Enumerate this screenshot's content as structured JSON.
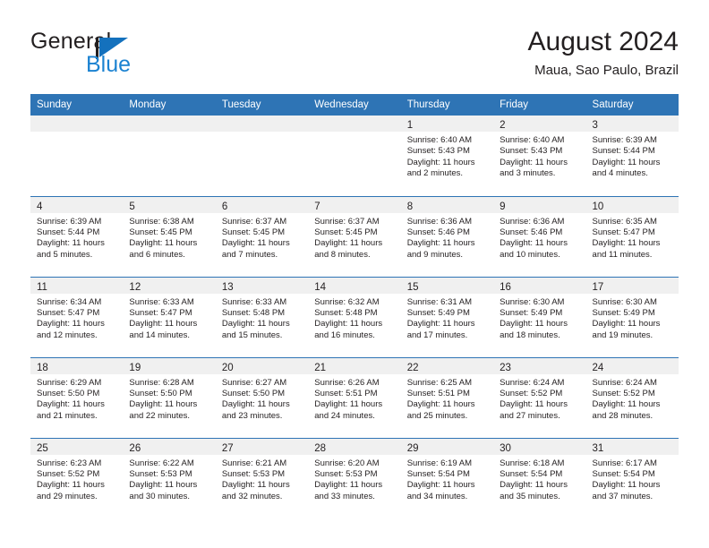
{
  "brand": {
    "name_top": "General",
    "name_bottom": "Blue",
    "flag_color": "#1471bd",
    "blue_text_color": "#1b82d1"
  },
  "header": {
    "title": "August 2024",
    "location": "Maua, Sao Paulo, Brazil"
  },
  "theme": {
    "header_blue": "#2e74b5",
    "day_band_gray": "#f0f0f0",
    "text_color": "#231f20"
  },
  "weekday_headers": [
    "Sunday",
    "Monday",
    "Tuesday",
    "Wednesday",
    "Thursday",
    "Friday",
    "Saturday"
  ],
  "weeks": [
    [
      {
        "day": "",
        "sunrise": "",
        "sunset": "",
        "daylight_line1": "",
        "daylight_line2": ""
      },
      {
        "day": "",
        "sunrise": "",
        "sunset": "",
        "daylight_line1": "",
        "daylight_line2": ""
      },
      {
        "day": "",
        "sunrise": "",
        "sunset": "",
        "daylight_line1": "",
        "daylight_line2": ""
      },
      {
        "day": "",
        "sunrise": "",
        "sunset": "",
        "daylight_line1": "",
        "daylight_line2": ""
      },
      {
        "day": "1",
        "sunrise": "Sunrise: 6:40 AM",
        "sunset": "Sunset: 5:43 PM",
        "daylight_line1": "Daylight: 11 hours",
        "daylight_line2": "and 2 minutes."
      },
      {
        "day": "2",
        "sunrise": "Sunrise: 6:40 AM",
        "sunset": "Sunset: 5:43 PM",
        "daylight_line1": "Daylight: 11 hours",
        "daylight_line2": "and 3 minutes."
      },
      {
        "day": "3",
        "sunrise": "Sunrise: 6:39 AM",
        "sunset": "Sunset: 5:44 PM",
        "daylight_line1": "Daylight: 11 hours",
        "daylight_line2": "and 4 minutes."
      }
    ],
    [
      {
        "day": "4",
        "sunrise": "Sunrise: 6:39 AM",
        "sunset": "Sunset: 5:44 PM",
        "daylight_line1": "Daylight: 11 hours",
        "daylight_line2": "and 5 minutes."
      },
      {
        "day": "5",
        "sunrise": "Sunrise: 6:38 AM",
        "sunset": "Sunset: 5:45 PM",
        "daylight_line1": "Daylight: 11 hours",
        "daylight_line2": "and 6 minutes."
      },
      {
        "day": "6",
        "sunrise": "Sunrise: 6:37 AM",
        "sunset": "Sunset: 5:45 PM",
        "daylight_line1": "Daylight: 11 hours",
        "daylight_line2": "and 7 minutes."
      },
      {
        "day": "7",
        "sunrise": "Sunrise: 6:37 AM",
        "sunset": "Sunset: 5:45 PM",
        "daylight_line1": "Daylight: 11 hours",
        "daylight_line2": "and 8 minutes."
      },
      {
        "day": "8",
        "sunrise": "Sunrise: 6:36 AM",
        "sunset": "Sunset: 5:46 PM",
        "daylight_line1": "Daylight: 11 hours",
        "daylight_line2": "and 9 minutes."
      },
      {
        "day": "9",
        "sunrise": "Sunrise: 6:36 AM",
        "sunset": "Sunset: 5:46 PM",
        "daylight_line1": "Daylight: 11 hours",
        "daylight_line2": "and 10 minutes."
      },
      {
        "day": "10",
        "sunrise": "Sunrise: 6:35 AM",
        "sunset": "Sunset: 5:47 PM",
        "daylight_line1": "Daylight: 11 hours",
        "daylight_line2": "and 11 minutes."
      }
    ],
    [
      {
        "day": "11",
        "sunrise": "Sunrise: 6:34 AM",
        "sunset": "Sunset: 5:47 PM",
        "daylight_line1": "Daylight: 11 hours",
        "daylight_line2": "and 12 minutes."
      },
      {
        "day": "12",
        "sunrise": "Sunrise: 6:33 AM",
        "sunset": "Sunset: 5:47 PM",
        "daylight_line1": "Daylight: 11 hours",
        "daylight_line2": "and 14 minutes."
      },
      {
        "day": "13",
        "sunrise": "Sunrise: 6:33 AM",
        "sunset": "Sunset: 5:48 PM",
        "daylight_line1": "Daylight: 11 hours",
        "daylight_line2": "and 15 minutes."
      },
      {
        "day": "14",
        "sunrise": "Sunrise: 6:32 AM",
        "sunset": "Sunset: 5:48 PM",
        "daylight_line1": "Daylight: 11 hours",
        "daylight_line2": "and 16 minutes."
      },
      {
        "day": "15",
        "sunrise": "Sunrise: 6:31 AM",
        "sunset": "Sunset: 5:49 PM",
        "daylight_line1": "Daylight: 11 hours",
        "daylight_line2": "and 17 minutes."
      },
      {
        "day": "16",
        "sunrise": "Sunrise: 6:30 AM",
        "sunset": "Sunset: 5:49 PM",
        "daylight_line1": "Daylight: 11 hours",
        "daylight_line2": "and 18 minutes."
      },
      {
        "day": "17",
        "sunrise": "Sunrise: 6:30 AM",
        "sunset": "Sunset: 5:49 PM",
        "daylight_line1": "Daylight: 11 hours",
        "daylight_line2": "and 19 minutes."
      }
    ],
    [
      {
        "day": "18",
        "sunrise": "Sunrise: 6:29 AM",
        "sunset": "Sunset: 5:50 PM",
        "daylight_line1": "Daylight: 11 hours",
        "daylight_line2": "and 21 minutes."
      },
      {
        "day": "19",
        "sunrise": "Sunrise: 6:28 AM",
        "sunset": "Sunset: 5:50 PM",
        "daylight_line1": "Daylight: 11 hours",
        "daylight_line2": "and 22 minutes."
      },
      {
        "day": "20",
        "sunrise": "Sunrise: 6:27 AM",
        "sunset": "Sunset: 5:50 PM",
        "daylight_line1": "Daylight: 11 hours",
        "daylight_line2": "and 23 minutes."
      },
      {
        "day": "21",
        "sunrise": "Sunrise: 6:26 AM",
        "sunset": "Sunset: 5:51 PM",
        "daylight_line1": "Daylight: 11 hours",
        "daylight_line2": "and 24 minutes."
      },
      {
        "day": "22",
        "sunrise": "Sunrise: 6:25 AM",
        "sunset": "Sunset: 5:51 PM",
        "daylight_line1": "Daylight: 11 hours",
        "daylight_line2": "and 25 minutes."
      },
      {
        "day": "23",
        "sunrise": "Sunrise: 6:24 AM",
        "sunset": "Sunset: 5:52 PM",
        "daylight_line1": "Daylight: 11 hours",
        "daylight_line2": "and 27 minutes."
      },
      {
        "day": "24",
        "sunrise": "Sunrise: 6:24 AM",
        "sunset": "Sunset: 5:52 PM",
        "daylight_line1": "Daylight: 11 hours",
        "daylight_line2": "and 28 minutes."
      }
    ],
    [
      {
        "day": "25",
        "sunrise": "Sunrise: 6:23 AM",
        "sunset": "Sunset: 5:52 PM",
        "daylight_line1": "Daylight: 11 hours",
        "daylight_line2": "and 29 minutes."
      },
      {
        "day": "26",
        "sunrise": "Sunrise: 6:22 AM",
        "sunset": "Sunset: 5:53 PM",
        "daylight_line1": "Daylight: 11 hours",
        "daylight_line2": "and 30 minutes."
      },
      {
        "day": "27",
        "sunrise": "Sunrise: 6:21 AM",
        "sunset": "Sunset: 5:53 PM",
        "daylight_line1": "Daylight: 11 hours",
        "daylight_line2": "and 32 minutes."
      },
      {
        "day": "28",
        "sunrise": "Sunrise: 6:20 AM",
        "sunset": "Sunset: 5:53 PM",
        "daylight_line1": "Daylight: 11 hours",
        "daylight_line2": "and 33 minutes."
      },
      {
        "day": "29",
        "sunrise": "Sunrise: 6:19 AM",
        "sunset": "Sunset: 5:54 PM",
        "daylight_line1": "Daylight: 11 hours",
        "daylight_line2": "and 34 minutes."
      },
      {
        "day": "30",
        "sunrise": "Sunrise: 6:18 AM",
        "sunset": "Sunset: 5:54 PM",
        "daylight_line1": "Daylight: 11 hours",
        "daylight_line2": "and 35 minutes."
      },
      {
        "day": "31",
        "sunrise": "Sunrise: 6:17 AM",
        "sunset": "Sunset: 5:54 PM",
        "daylight_line1": "Daylight: 11 hours",
        "daylight_line2": "and 37 minutes."
      }
    ]
  ]
}
